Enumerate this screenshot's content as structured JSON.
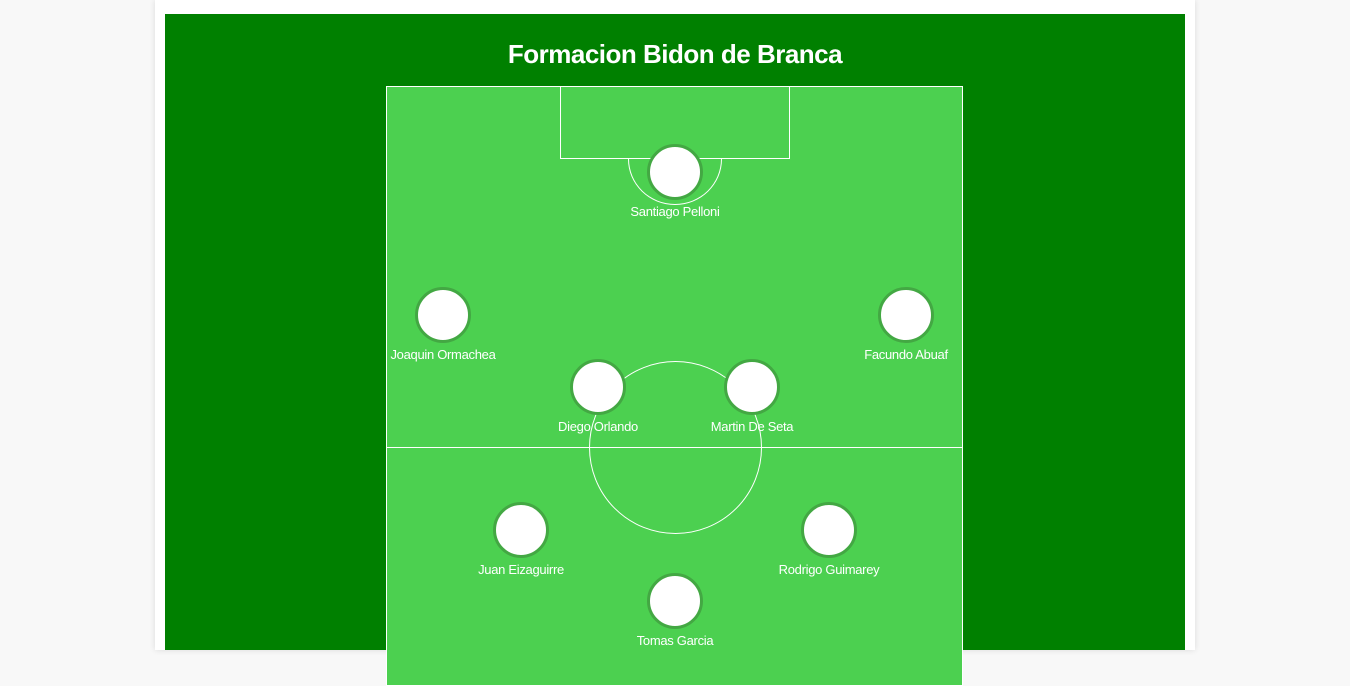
{
  "title": "Formacion Bidon de Branca",
  "players": [
    {
      "name": "Santiago Pelloni",
      "role": "goalkeeper"
    },
    {
      "name": "Joaquin Ormachea",
      "role": "left"
    },
    {
      "name": "Facundo Abuaf",
      "role": "right"
    },
    {
      "name": "Diego Orlando",
      "role": "center-left"
    },
    {
      "name": "Martin De Seta",
      "role": "center-right"
    },
    {
      "name": "Juan Eizaguirre",
      "role": "left-forward"
    },
    {
      "name": "Rodrigo Guimarey",
      "role": "right-forward"
    },
    {
      "name": "Tomas Garcia",
      "role": "striker"
    }
  ],
  "colors": {
    "panel": "#008000",
    "pitch": "#4cd050",
    "lines": "#ffffff",
    "avatar_border": "#43a843",
    "page_background": "#f8f8f8"
  }
}
